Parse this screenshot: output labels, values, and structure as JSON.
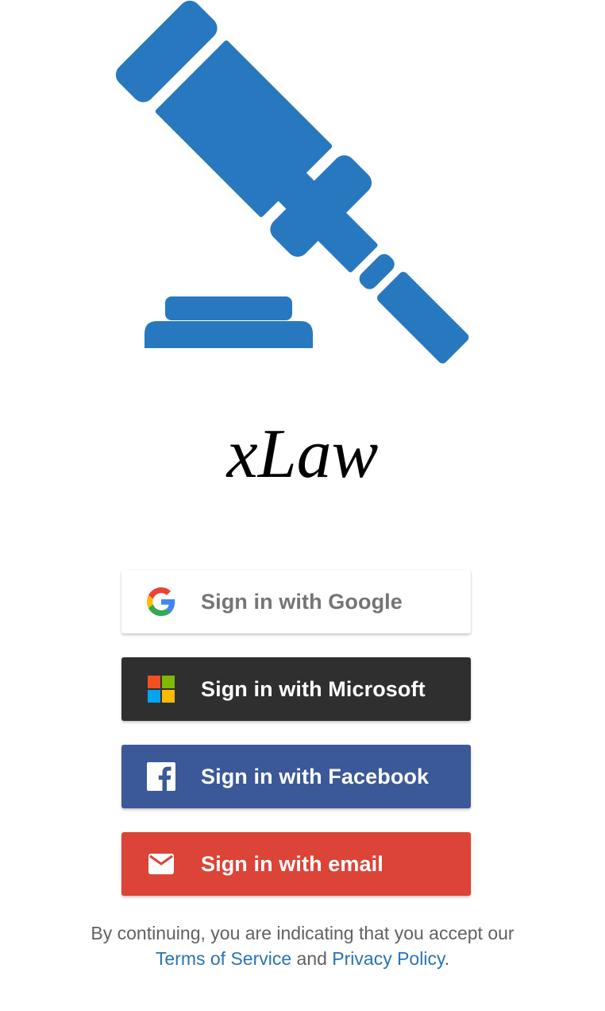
{
  "brand": {
    "title": "xLaw",
    "logo_icon": "gavel-icon",
    "logo_color": "#2878c0"
  },
  "signin": {
    "buttons": [
      {
        "id": "google",
        "label": "Sign in with Google",
        "icon": "google-icon",
        "bg": "#ffffff",
        "text_color": "#757575"
      },
      {
        "id": "microsoft",
        "label": "Sign in with Microsoft",
        "icon": "microsoft-icon",
        "bg": "#2f2f2f",
        "text_color": "#ffffff"
      },
      {
        "id": "facebook",
        "label": "Sign in with Facebook",
        "icon": "facebook-icon",
        "bg": "#3b5998",
        "text_color": "#ffffff"
      },
      {
        "id": "email",
        "label": "Sign in with email",
        "icon": "mail-icon",
        "bg": "#db4437",
        "text_color": "#ffffff"
      }
    ]
  },
  "legal": {
    "prefix": "By continuing, you are indicating that you accept our",
    "terms_link": "Terms of Service",
    "conjunction": "and",
    "privacy_link": "Privacy Policy",
    "suffix": ".",
    "link_color": "#2a73b5"
  }
}
